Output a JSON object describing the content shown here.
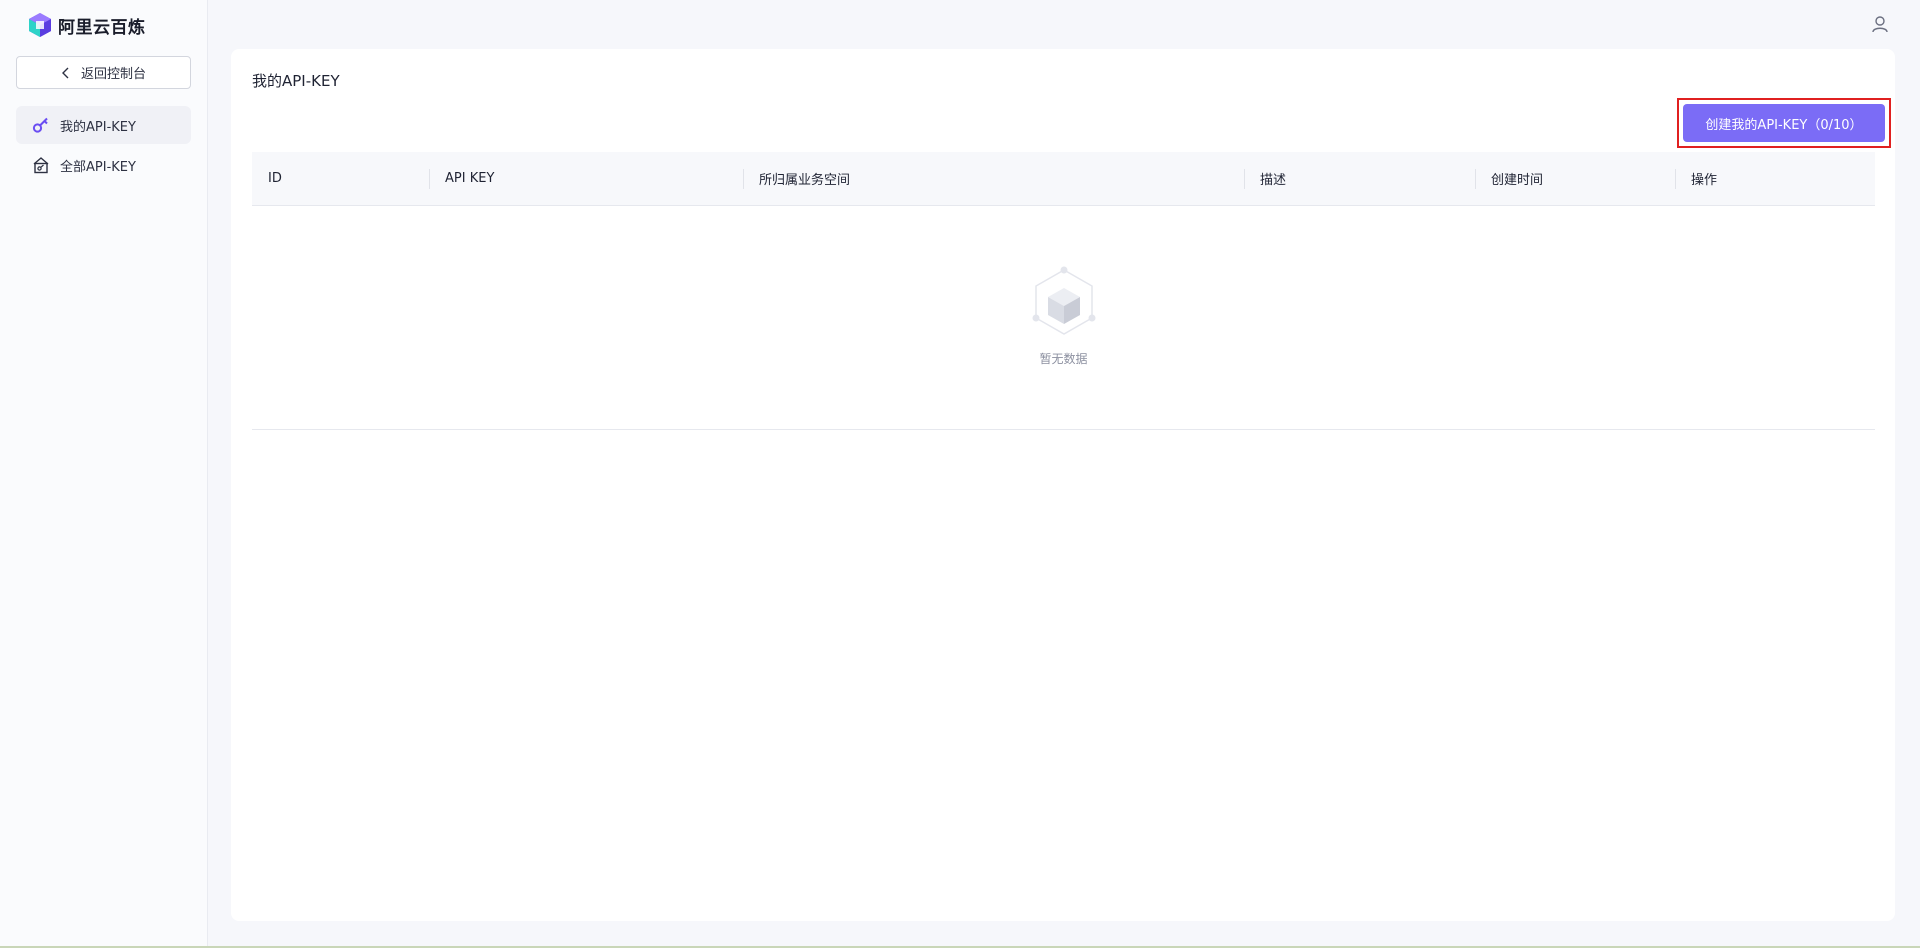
{
  "app": {
    "brand": "阿里云百炼"
  },
  "sidebar": {
    "back_label": "返回控制台",
    "items": [
      {
        "label": "我的API-KEY",
        "active": true,
        "icon": "key-icon"
      },
      {
        "label": "全部API-KEY",
        "active": false,
        "icon": "house-key-icon"
      }
    ]
  },
  "main": {
    "title": "我的API-KEY",
    "create_button": "创建我的API-KEY（0/10）",
    "table": {
      "columns": [
        "ID",
        "API KEY",
        "所归属业务空间",
        "描述",
        "创建时间",
        "操作"
      ],
      "rows": [],
      "empty_text": "暂无数据"
    }
  },
  "colors": {
    "accent": "#7b6cf6",
    "highlight_border": "#e02020"
  }
}
